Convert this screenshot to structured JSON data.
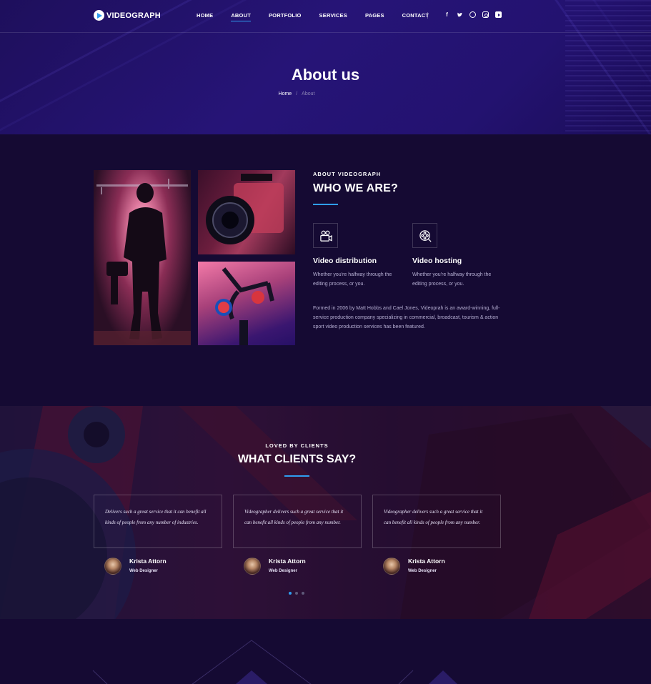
{
  "brand": {
    "name": "VIDEOGRAPH"
  },
  "nav": {
    "items": [
      {
        "label": "HOME",
        "active": false
      },
      {
        "label": "ABOUT",
        "active": true
      },
      {
        "label": "PORTFOLIO",
        "active": false
      },
      {
        "label": "SERVICES",
        "active": false
      },
      {
        "label": "PAGES",
        "active": false
      },
      {
        "label": "CONTACT",
        "active": false
      }
    ],
    "socials": [
      "facebook-icon",
      "twitter-icon",
      "dribbble-icon",
      "instagram-icon",
      "youtube-icon"
    ]
  },
  "hero": {
    "title": "About us",
    "breadcrumb": {
      "home": "Home",
      "separator": "/",
      "current": "About"
    }
  },
  "about": {
    "eyebrow": "ABOUT VIDEOGRAPH",
    "heading": "WHO WE ARE?",
    "features": [
      {
        "icon": "video-camera-icon",
        "title": "Video distribution",
        "text": "Whether you're halfway through the editing process, or you."
      },
      {
        "icon": "film-reel-icon",
        "title": "Video hosting",
        "text": "Whether you're halfway through the editing process, or you."
      }
    ],
    "paragraph": "Formed in 2006 by Matt Hobbs and Cael Jones, Videoprah is an award-winning, full-service production company specializing in commercial, broadcast, tourism & action sport video production services has been featured."
  },
  "testimonials": {
    "eyebrow": "LOVED BY CLIENTS",
    "heading": "WHAT CLIENTS SAY?",
    "items": [
      {
        "quote": "Delivers such a great service that it can benefit all kinds of people from any number of industries.",
        "name": "Krista Attorn",
        "role": "Web Designer"
      },
      {
        "quote": "Videographer delivers such a great service that it can benefit all kinds of people from any number.",
        "name": "Krista Attorn",
        "role": "Web Designer"
      },
      {
        "quote": "Videographer delivers such a great service that it can benefit all kinds of people from any number.",
        "name": "Krista Attorn",
        "role": "Web Designer"
      }
    ],
    "active_dot": 1,
    "dot_count": 3
  },
  "colors": {
    "accent": "#2f9ef0",
    "background": "#150a33",
    "hero": "#261477"
  }
}
